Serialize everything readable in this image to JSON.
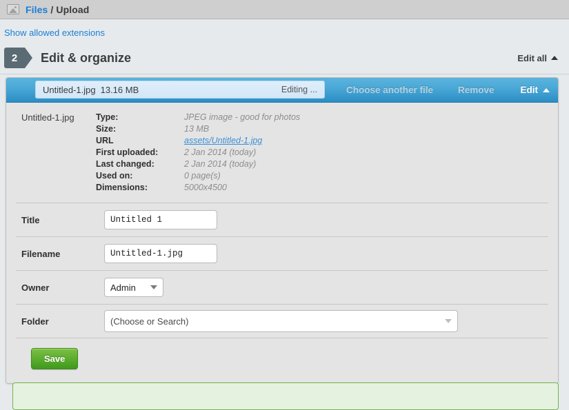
{
  "header": {
    "icon": "image-icon",
    "breadcrumb_link": "Files",
    "breadcrumb_sep": "/",
    "breadcrumb_current": "Upload"
  },
  "subbar": {
    "show_extensions_link": "Show allowed extensions"
  },
  "step": {
    "number": "2",
    "title": "Edit & organize",
    "edit_all_label": "Edit all",
    "edit_all_caret": "caret-up-icon"
  },
  "file_panel": {
    "toolbar": {
      "file_name": "Untitled-1.jpg",
      "file_size": "13.16 MB",
      "editing_status": "Editing ...",
      "choose_another_file": "Choose another file",
      "remove": "Remove",
      "edit": "Edit",
      "edit_caret": "caret-up-icon"
    },
    "details": {
      "filename_label": "Untitled-1.jpg",
      "rows": [
        {
          "key": "Type:",
          "value": "JPEG image - good for photos",
          "is_link": false
        },
        {
          "key": "Size:",
          "value": "13 MB",
          "is_link": false
        },
        {
          "key": "URL",
          "value": "assets/Untitled-1.jpg",
          "is_link": true
        },
        {
          "key": "First uploaded:",
          "value": "2 Jan 2014 (today)",
          "is_link": false
        },
        {
          "key": "Last changed:",
          "value": "2 Jan 2014 (today)",
          "is_link": false
        },
        {
          "key": "Used on:",
          "value": "0 page(s)",
          "is_link": false
        },
        {
          "key": "Dimensions:",
          "value": "5000x4500",
          "is_link": false
        }
      ]
    },
    "form": {
      "title_label": "Title",
      "title_value": "Untitled 1",
      "filename_label": "Filename",
      "filename_value": "Untitled-1.jpg",
      "owner_label": "Owner",
      "owner_value": "Admin",
      "folder_label": "Folder",
      "folder_placeholder": "(Choose or Search)"
    },
    "save_label": "Save"
  },
  "colors": {
    "accent_blue": "#2b8dc4",
    "link_blue": "#1a7fd4",
    "save_green": "#5aab2e",
    "notice_green_border": "#6fb44a",
    "step_badge": "#5b6b74"
  }
}
